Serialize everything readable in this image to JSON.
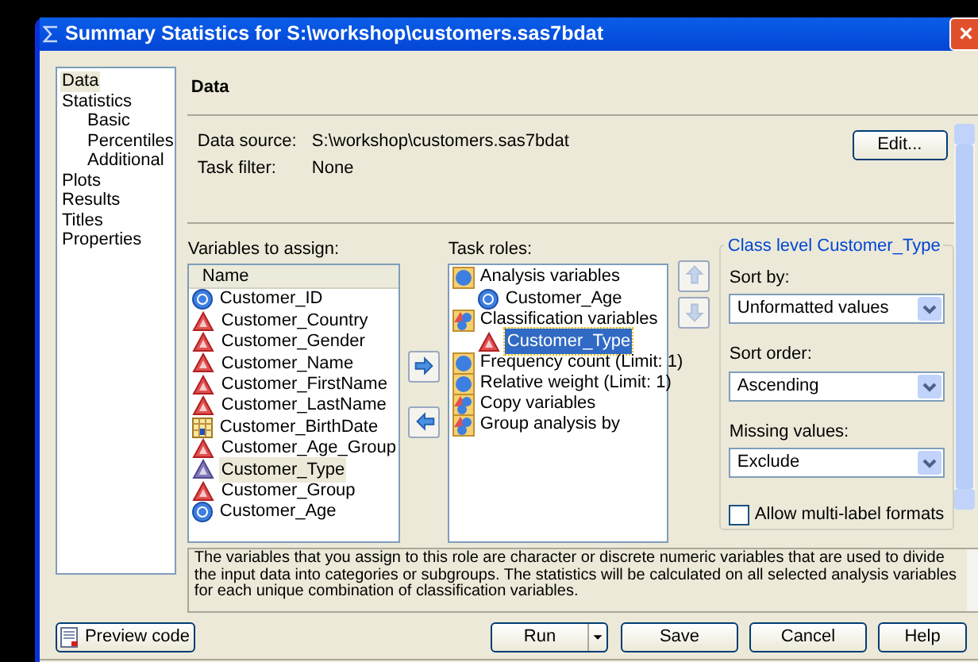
{
  "window": {
    "title": "Summary Statistics for S:\\workshop\\customers.sas7bdat",
    "close": "×"
  },
  "sidebar": {
    "items": [
      {
        "label": "Data",
        "selected": true
      },
      {
        "label": "Statistics",
        "selected": false,
        "children": [
          {
            "label": "Basic",
            "selected": false
          },
          {
            "label": "Percentiles",
            "selected": false
          },
          {
            "label": "Additional",
            "selected": false
          }
        ]
      },
      {
        "label": "Plots",
        "selected": false
      },
      {
        "label": "Results",
        "selected": false
      },
      {
        "label": "Titles",
        "selected": false
      },
      {
        "label": "Properties",
        "selected": false
      }
    ]
  },
  "heading": "Data",
  "info": [
    {
      "label": "Data source:",
      "value": "S:\\workshop\\customers.sas7bdat"
    },
    {
      "label": "Task filter:",
      "value": "None"
    }
  ],
  "edit_button": "Edit...",
  "variables": {
    "label": "Variables to assign:",
    "column": "Name",
    "items": [
      {
        "name": "Customer_ID",
        "kind": "numeric",
        "selected": false
      },
      {
        "name": "Customer_Country",
        "kind": "character",
        "selected": false
      },
      {
        "name": "Customer_Gender",
        "kind": "character",
        "selected": false
      },
      {
        "name": "Customer_Name",
        "kind": "character",
        "selected": false
      },
      {
        "name": "Customer_FirstName",
        "kind": "character",
        "selected": false
      },
      {
        "name": "Customer_LastName",
        "kind": "character",
        "selected": false
      },
      {
        "name": "Customer_BirthDate",
        "kind": "date",
        "selected": false
      },
      {
        "name": "Customer_Age_Group",
        "kind": "character",
        "selected": false
      },
      {
        "name": "Customer_Type",
        "kind": "character",
        "selected": true
      },
      {
        "name": "Customer_Group",
        "kind": "character",
        "selected": false
      },
      {
        "name": "Customer_Age",
        "kind": "numeric",
        "selected": false
      }
    ]
  },
  "task_roles": {
    "label": "Task roles:",
    "items": [
      {
        "label": "Analysis variables",
        "kind": "numeric",
        "children": [
          {
            "name": "Customer_Age",
            "kind": "numeric",
            "selected": false
          }
        ]
      },
      {
        "label": "Classification variables",
        "kind": "mixed",
        "children": [
          {
            "name": "Customer_Type",
            "kind": "character",
            "selected": true
          }
        ]
      },
      {
        "label": "Frequency count  (Limit: 1)",
        "kind": "numeric"
      },
      {
        "label": "Relative weight  (Limit: 1)",
        "kind": "numeric"
      },
      {
        "label": "Copy variables",
        "kind": "mixed"
      },
      {
        "label": "Group analysis by",
        "kind": "mixed"
      }
    ]
  },
  "class_level": {
    "title": "Class level Customer_Type",
    "fields": [
      {
        "label": "Sort by:",
        "value": "Unformatted values"
      },
      {
        "label": "Sort order:",
        "value": "Ascending"
      },
      {
        "label": "Missing values:",
        "value": "Exclude"
      }
    ],
    "checkbox": {
      "label": "Allow multi-label formats",
      "checked": false
    }
  },
  "description": "The variables that you assign to this role are character or discrete numeric variables that are used to divide the input data into categories or subgroups. The statistics will be calculated on all selected analysis variables for each unique combination of classification variables.",
  "buttons": {
    "preview": "Preview code",
    "run": "Run",
    "save": "Save",
    "cancel": "Cancel",
    "help": "Help"
  }
}
